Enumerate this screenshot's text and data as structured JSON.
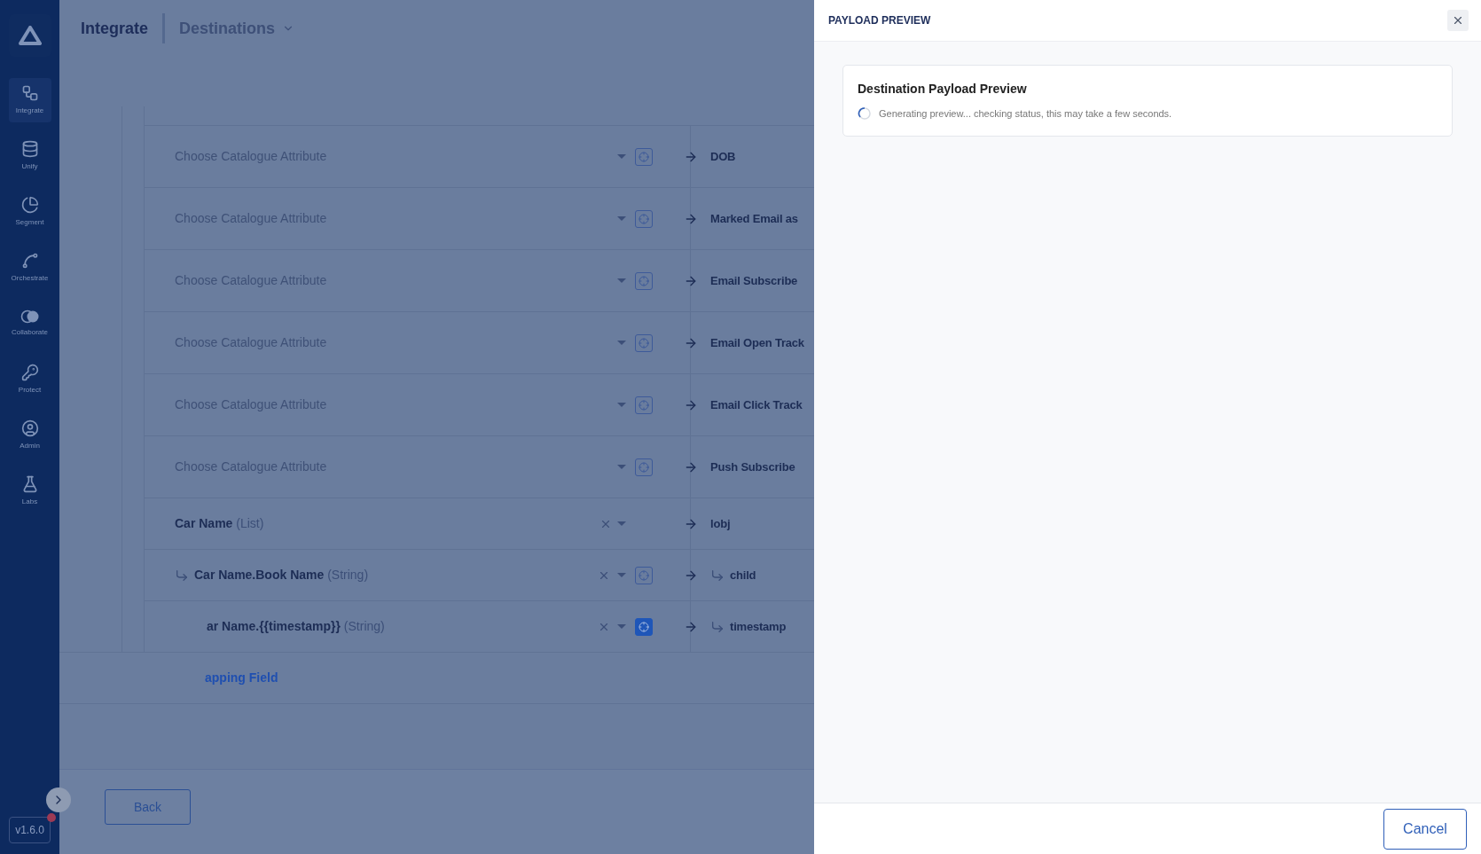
{
  "sidebar": {
    "items": [
      {
        "label": "Integrate",
        "selected": true
      },
      {
        "label": "Unify",
        "selected": false
      },
      {
        "label": "Segment",
        "selected": false
      },
      {
        "label": "Orchestrate",
        "selected": false
      },
      {
        "label": "Collaborate",
        "selected": false
      },
      {
        "label": "Protect",
        "selected": false
      },
      {
        "label": "Admin",
        "selected": false
      },
      {
        "label": "Labs",
        "selected": false
      }
    ],
    "version": "v1.6.0"
  },
  "header": {
    "title": "Integrate",
    "breadcrumb": "Destinations"
  },
  "mappings": [
    {
      "kind": "placeholder",
      "placeholder": "Choose Catalogue Attribute",
      "target": "DOB",
      "icon_selected": false
    },
    {
      "kind": "placeholder",
      "placeholder": "Choose Catalogue Attribute",
      "target": "Marked Email as",
      "icon_selected": false
    },
    {
      "kind": "placeholder",
      "placeholder": "Choose Catalogue Attribute",
      "target": "Email Subscribe",
      "icon_selected": false
    },
    {
      "kind": "placeholder",
      "placeholder": "Choose Catalogue Attribute",
      "target": "Email Open Track",
      "icon_selected": false
    },
    {
      "kind": "placeholder",
      "placeholder": "Choose Catalogue Attribute",
      "target": "Email Click Track",
      "icon_selected": false
    },
    {
      "kind": "placeholder",
      "placeholder": "Choose Catalogue Attribute",
      "target": "Push Subscribe",
      "icon_selected": false
    },
    {
      "kind": "list",
      "source": "Car Name",
      "type": "(List)",
      "target": "lobj"
    },
    {
      "kind": "child",
      "source": "Car Name.Book Name",
      "type": "(String)",
      "target": "child",
      "icon_selected": false
    },
    {
      "kind": "clipped",
      "source": "ar Name.{{timestamp}}",
      "type": "(String)",
      "target": "timestamp",
      "icon_selected": true
    }
  ],
  "add_link": "apping Field",
  "back_button": "Back",
  "panel": {
    "title": "PAYLOAD PREVIEW",
    "card_title": "Destination Payload Preview",
    "status": "Generating preview... checking status, this may take a few seconds.",
    "cancel_button": "Cancel"
  }
}
